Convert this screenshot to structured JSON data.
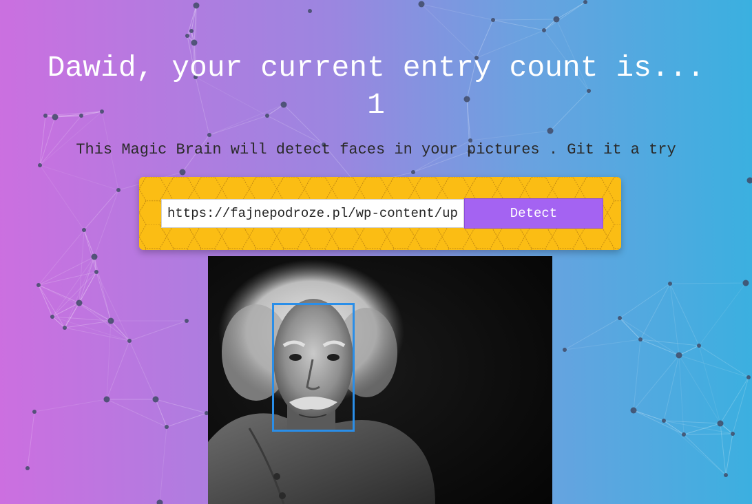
{
  "header": {
    "greeting": "Dawid, your current entry count is...",
    "entry_count": "1"
  },
  "description": "This Magic Brain will detect faces in your pictures . Git it a try",
  "form": {
    "url_value": "https://fajnepodroze.pl/wp-content/uploads/einstein.jpg",
    "detect_label": "Detect"
  },
  "image": {
    "alt": "Albert Einstein portrait",
    "faces_detected": 1
  },
  "colors": {
    "panel": "#fbbd14",
    "button": "#a463f2",
    "face_box": "#2a8ee8"
  }
}
